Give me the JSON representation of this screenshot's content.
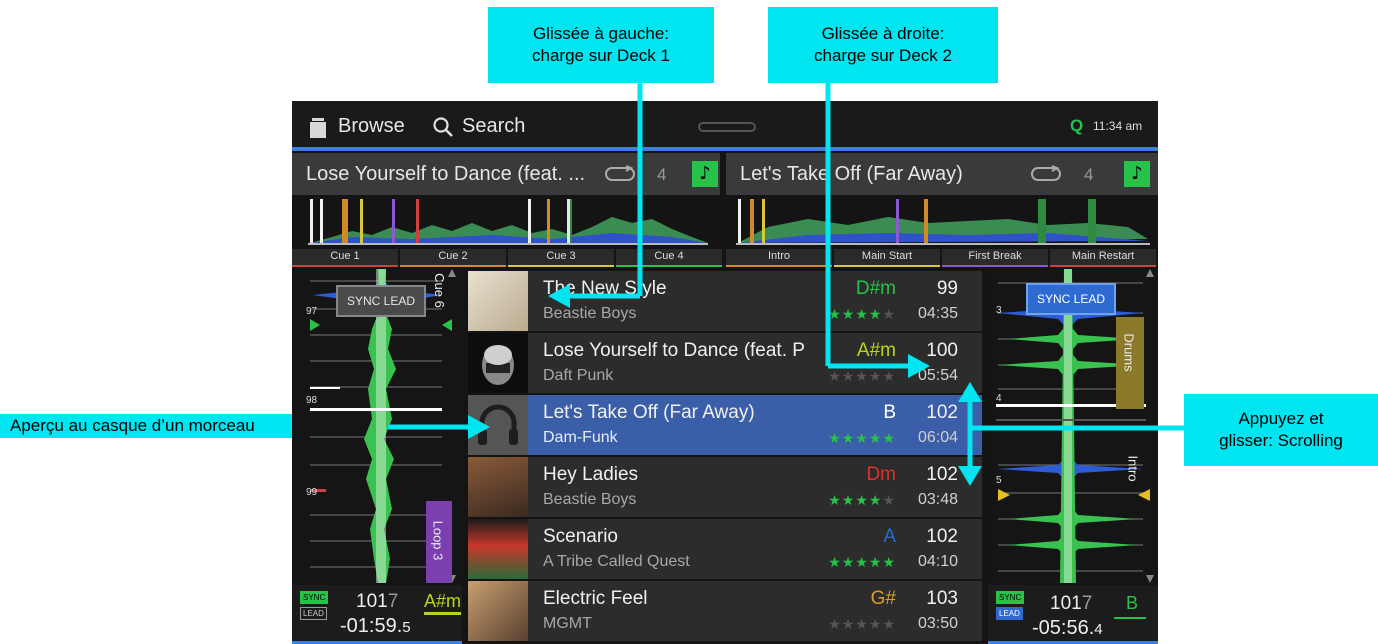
{
  "callouts": {
    "left_swipe": [
      "Glissée à gauche:",
      "charge sur Deck 1"
    ],
    "right_swipe": [
      "Glissée à droite:",
      "charge sur Deck 2"
    ],
    "preview": "Aperçu au casque d’un morceau",
    "scroll": [
      "Appuyez et",
      "glisser: Scrolling"
    ]
  },
  "topbar": {
    "browse": "Browse",
    "search": "Search",
    "q_icon": "Q",
    "time": "11:34 am"
  },
  "deck1": {
    "title": "Lose Yourself to Dance (feat. ...",
    "loop_count": "4",
    "cues": [
      "Cue 1",
      "Cue 2",
      "Cue 3",
      "Cue 4"
    ],
    "sync_label": "SYNC LEAD",
    "side_label_top": "Cue 6",
    "side_label_bottom": "Loop 3",
    "beat_markers": [
      "97",
      "98",
      "99"
    ],
    "tags": [
      "SYNC",
      "LEAD"
    ],
    "bpm_main": "101",
    "bpm_sub": "7",
    "key": "A#m",
    "time_main": "-01:59.",
    "time_sub": "5"
  },
  "deck2": {
    "title": "Let's Take Off (Far Away)",
    "loop_count": "4",
    "cues": [
      "Intro",
      "Main Start",
      "First Break",
      "Main Restart"
    ],
    "sync_label": "SYNC LEAD",
    "side_label_top": "Drums",
    "side_label_bottom": "Intro",
    "beat_markers": [
      "3",
      "4",
      "5"
    ],
    "tags": [
      "SYNC",
      "LEAD"
    ],
    "bpm_main": "101",
    "bpm_sub": "7",
    "key": "B",
    "time_main": "-05:56.",
    "time_sub": "4"
  },
  "tracks": [
    {
      "title": "The New Style",
      "artist": "Beastie Boys",
      "key": "D#m",
      "key_color": "#27c24a",
      "bpm": "99",
      "stars": "★★★★",
      "stars_off": "★",
      "duration": "04:35"
    },
    {
      "title": "Lose Yourself to Dance (feat. P",
      "artist": "Daft Punk",
      "key": "A#m",
      "key_color": "#b8d619",
      "bpm": "100",
      "stars": "",
      "stars_off": "★★★★★",
      "duration": "05:54"
    },
    {
      "title": "Let's Take Off (Far Away)",
      "artist": "Dam-Funk",
      "key": "B",
      "key_color": "#ffffff",
      "bpm": "102",
      "stars": "★★★★★",
      "stars_off": "",
      "duration": "06:04"
    },
    {
      "title": "Hey Ladies",
      "artist": "Beastie Boys",
      "key": "Dm",
      "key_color": "#e0302a",
      "bpm": "102",
      "stars": "★★★★",
      "stars_off": "★",
      "duration": "03:48"
    },
    {
      "title": "Scenario",
      "artist": "A Tribe Called Quest",
      "key": "A",
      "key_color": "#2a6dc8",
      "bpm": "102",
      "stars": "★★★★★",
      "stars_off": "",
      "duration": "04:10"
    },
    {
      "title": "Electric Feel",
      "artist": "MGMT",
      "key": "G#",
      "key_color": "#d9a020",
      "bpm": "103",
      "stars": "",
      "stars_off": "★★★★★",
      "duration": "03:50"
    }
  ],
  "colors": {
    "accent_blue": "#3d7fdc",
    "cyan": "#00e6f0",
    "green": "#27c24a",
    "selected_row": "#3b5ea8"
  }
}
